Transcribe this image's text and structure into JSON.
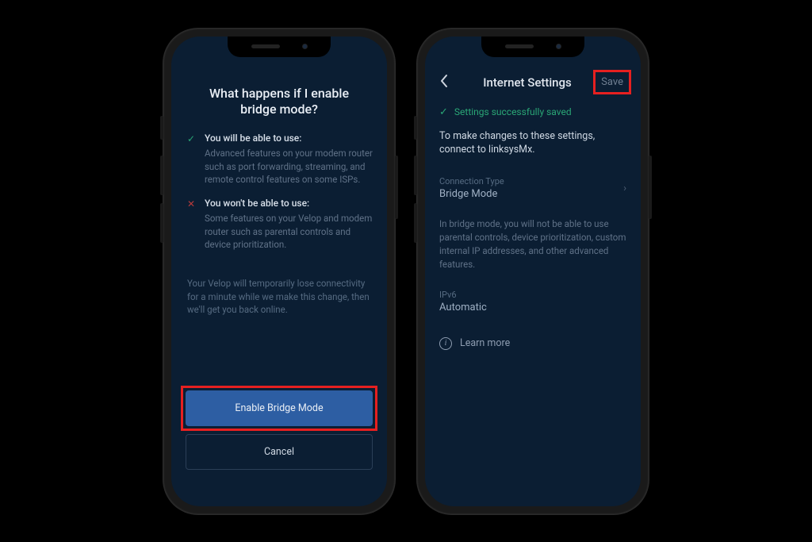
{
  "left": {
    "heading": "What happens if I enable bridge mode?",
    "able": {
      "title": "You will be able to use:",
      "desc": "Advanced features on your modem router such as port forwarding, streaming, and remote control features on some ISPs."
    },
    "unable": {
      "title": "You won't be able to use:",
      "desc": "Some features on your Velop and modem router such as parental controls and device prioritization."
    },
    "note": "Your Velop will temporarily lose connectivity for a minute while we make this change, then we'll get you back online.",
    "primary_btn": "Enable Bridge Mode",
    "cancel_btn": "Cancel"
  },
  "right": {
    "title": "Internet Settings",
    "save": "Save",
    "status": "Settings successfully saved",
    "instruction": "To make changes to these settings, connect to linksysMx.",
    "conn_label": "Connection Type",
    "conn_value": "Bridge Mode",
    "mode_desc": "In bridge mode, you will not be able to use parental controls, device prioritization, custom internal IP addresses, and other advanced features.",
    "ipv6_label": "IPv6",
    "ipv6_value": "Automatic",
    "learn_more": "Learn more"
  }
}
